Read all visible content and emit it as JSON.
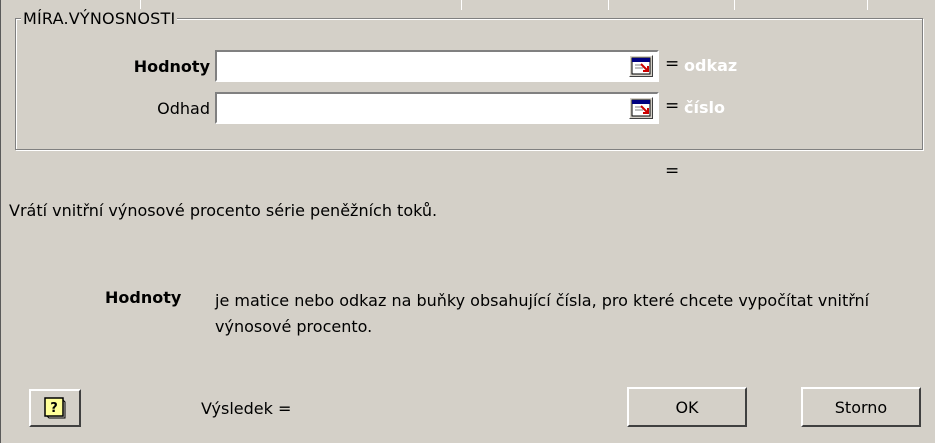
{
  "dialog": {
    "group_title": "MÍRA.VÝNOSNOSTI",
    "arguments": [
      {
        "label": "Hodnoty",
        "value": "",
        "result_hint": "odkaz"
      },
      {
        "label": "Odhad",
        "value": "",
        "result_hint": "číslo"
      }
    ],
    "equals_sign": "=",
    "formula_result_prefix": "=",
    "function_description": "Vrátí vnitřní výnosové procento série peněžních toků.",
    "argument_help": {
      "name": "Hodnoty",
      "text": "je matice nebo odkaz na buňky obsahující čísla, pro které chcete vypočítat vnitřní výnosové procento."
    },
    "result_label": "Výsledek =",
    "buttons": {
      "ok": "OK",
      "cancel": "Storno"
    }
  },
  "icons": {
    "help": "help-question-icon",
    "collapse": "collapse-dialog-icon"
  },
  "colors": {
    "dialog_bg": "#d4d0c8",
    "hint_text": "#ffffff",
    "field_bg": "#ffffff"
  }
}
